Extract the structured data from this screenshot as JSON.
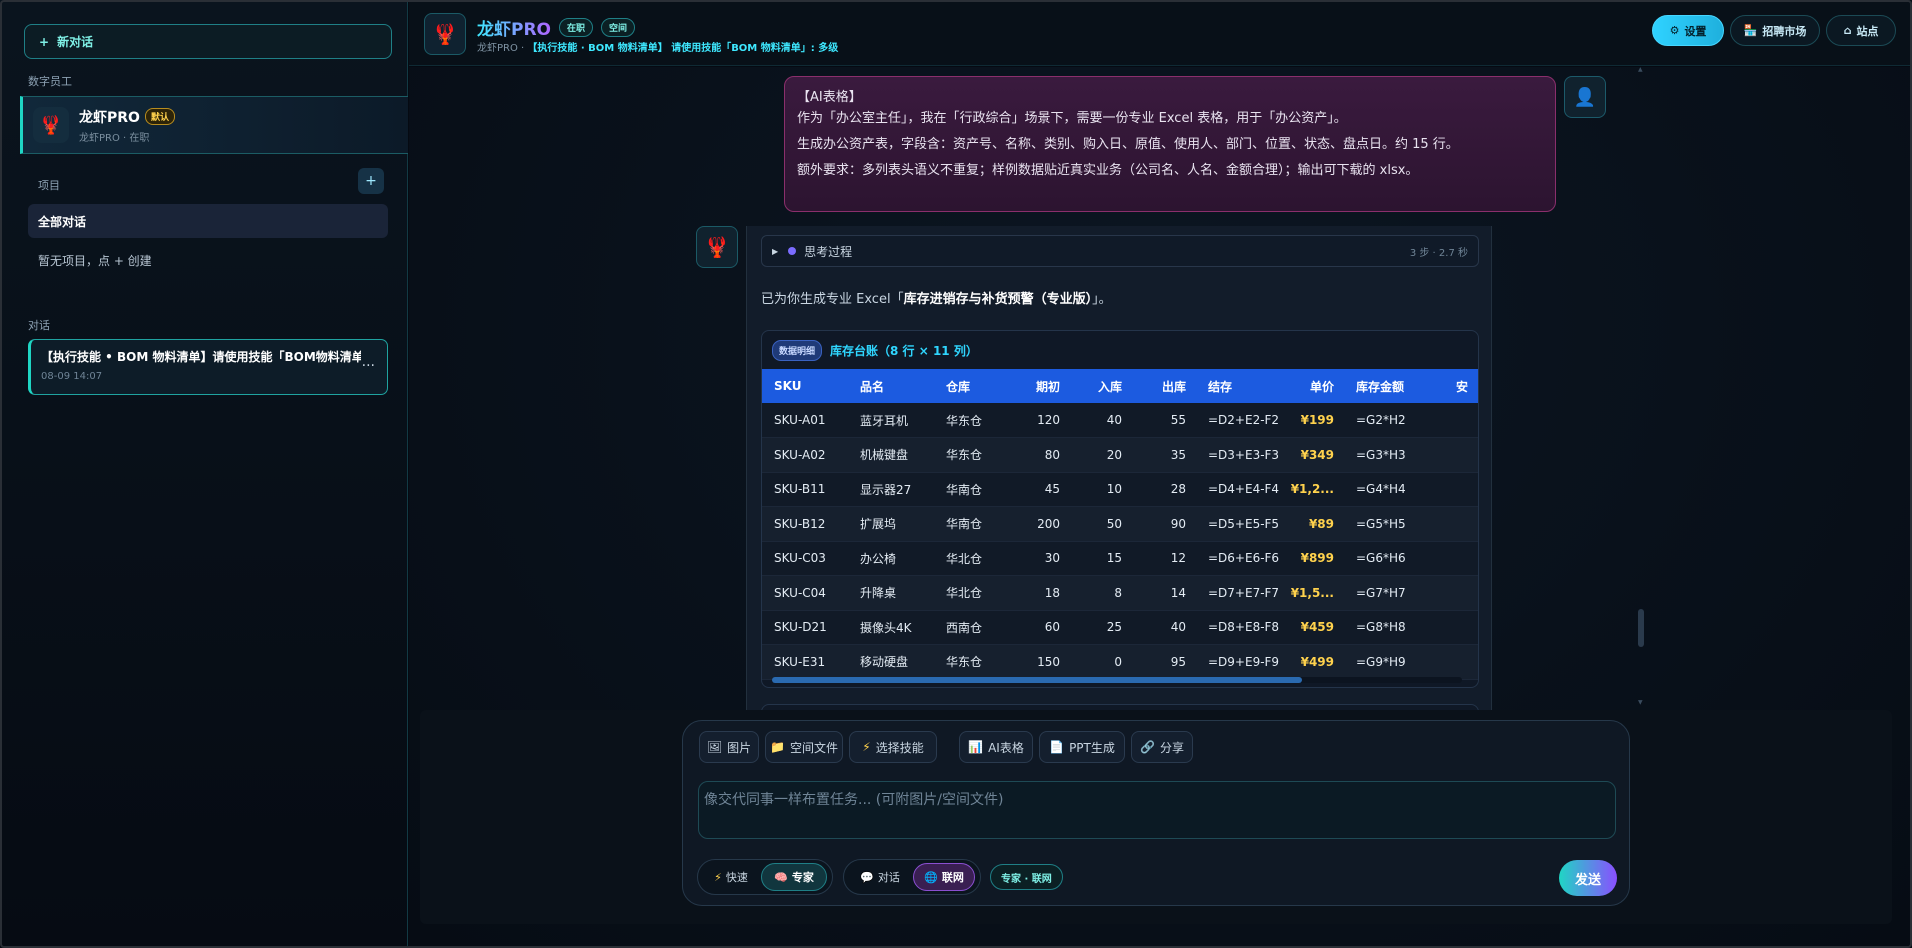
{
  "sidebar": {
    "new_chat_label": "新对话",
    "section_employees": "数字员工",
    "agent": {
      "name": "龙虾PRO",
      "badge": "默认",
      "sub": "龙虾PRO · 在职"
    },
    "section_projects": "项目",
    "all_conversations": "全部对话",
    "no_projects": "暂无项目，点 + 创建",
    "section_conversations": "对话",
    "conversation": {
      "title": "【执行技能 • BOM 物料清单】请使用技能「BOM物料清单」：多级",
      "date": "08-09 14:07"
    }
  },
  "header": {
    "title": "龙虾PRO",
    "pill_status": "在职",
    "pill_space": "空间",
    "sub_prefix": "龙虾PRO · ",
    "sub_task": "【执行技能 · BOM 物料清单】 请使用技能「BOM 物料清单」: 多级",
    "btn_settings": "设置",
    "btn_market": "招聘市场",
    "btn_site": "站点"
  },
  "user_message": {
    "line1": "【AI表格】",
    "line2": "作为「办公室主任」，我在「行政综合」场景下，需要一份专业 Excel 表格，用于「办公资产」。",
    "line3": "生成办公资产表，字段含：资产号、名称、类别、购入日、原值、使用人、部门、位置、状态、盘点日。约 15 行。",
    "line4": "额外要求：多列表头语义不重复；样例数据贴近真实业务（公司名、人名、金额合理）；输出可下载的 xlsx。"
  },
  "bot": {
    "think_label": "思考过程",
    "think_meta": "3 步 · 2.7 秒",
    "text_prefix": "已为你生成专业 Excel「",
    "text_title": "库存进销存与补货预警（专业版）",
    "text_suffix": "」。",
    "sheet_tag": "数据明细",
    "sheet_title": "库存台账（8 行 × 11 列）"
  },
  "table": {
    "headers": [
      "SKU",
      "品名",
      "仓库",
      "期初",
      "入库",
      "出库",
      "结存",
      "单价",
      "库存金额",
      "安"
    ],
    "rows": [
      [
        "SKU-A01",
        "蓝牙耳机",
        "华东仓",
        "120",
        "40",
        "55",
        "=D2+E2-F2",
        "¥199",
        "=G2*H2"
      ],
      [
        "SKU-A02",
        "机械键盘",
        "华东仓",
        "80",
        "20",
        "35",
        "=D3+E3-F3",
        "¥349",
        "=G3*H3"
      ],
      [
        "SKU-B11",
        "显示器27",
        "华南仓",
        "45",
        "10",
        "28",
        "=D4+E4-F4",
        "¥1,2...",
        "=G4*H4"
      ],
      [
        "SKU-B12",
        "扩展坞",
        "华南仓",
        "200",
        "50",
        "90",
        "=D5+E5-F5",
        "¥89",
        "=G5*H5"
      ],
      [
        "SKU-C03",
        "办公椅",
        "华北仓",
        "30",
        "15",
        "12",
        "=D6+E6-F6",
        "¥899",
        "=G6*H6"
      ],
      [
        "SKU-C04",
        "升降桌",
        "华北仓",
        "18",
        "8",
        "14",
        "=D7+E7-F7",
        "¥1,5...",
        "=G7*H7"
      ],
      [
        "SKU-D21",
        "摄像头4K",
        "西南仓",
        "60",
        "25",
        "40",
        "=D8+E8-F8",
        "¥459",
        "=G8*H8"
      ],
      [
        "SKU-E31",
        "移动硬盘",
        "华东仓",
        "150",
        "0",
        "95",
        "=D9+E9-F9",
        "¥499",
        "=G9*H9"
      ]
    ]
  },
  "composer": {
    "tools": [
      "图片",
      "空间文件",
      "选择技能",
      "AI表格",
      "PPT生成",
      "分享"
    ],
    "placeholder": "像交代同事一样布置任务... (可附图片/空间文件)",
    "speed_fast": "快速",
    "speed_expert": "专家",
    "mode_chat": "对话",
    "mode_web": "联网",
    "mode_tag": "专家 · 联网",
    "send": "发送"
  }
}
